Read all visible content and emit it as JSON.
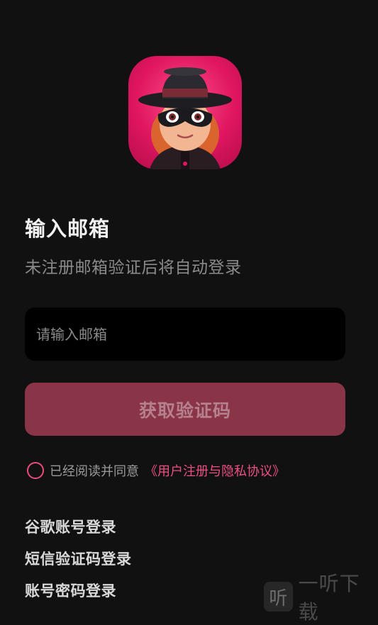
{
  "app": {
    "title": "输入邮箱",
    "subtitle": "未注册邮箱验证后将自动登录"
  },
  "email": {
    "value": "",
    "placeholder": "请输入邮箱"
  },
  "actions": {
    "get_code_label": "获取验证码"
  },
  "agreement": {
    "checked": false,
    "text": "已经阅读并同意",
    "link_text": "《用户注册与隐私协议》"
  },
  "alt_logins": [
    {
      "label": "谷歌账号登录"
    },
    {
      "label": "短信验证码登录"
    },
    {
      "label": "账号密码登录"
    }
  ],
  "watermark": {
    "icon": "听",
    "text": "一听下载"
  },
  "colors": {
    "background": "#121112",
    "accent": "#ee4f83",
    "button_bg": "#8a3448",
    "input_bg": "#000000"
  },
  "icons": {
    "app_avatar": "masked-character-icon",
    "agree_radio": "radio-circle-icon"
  }
}
